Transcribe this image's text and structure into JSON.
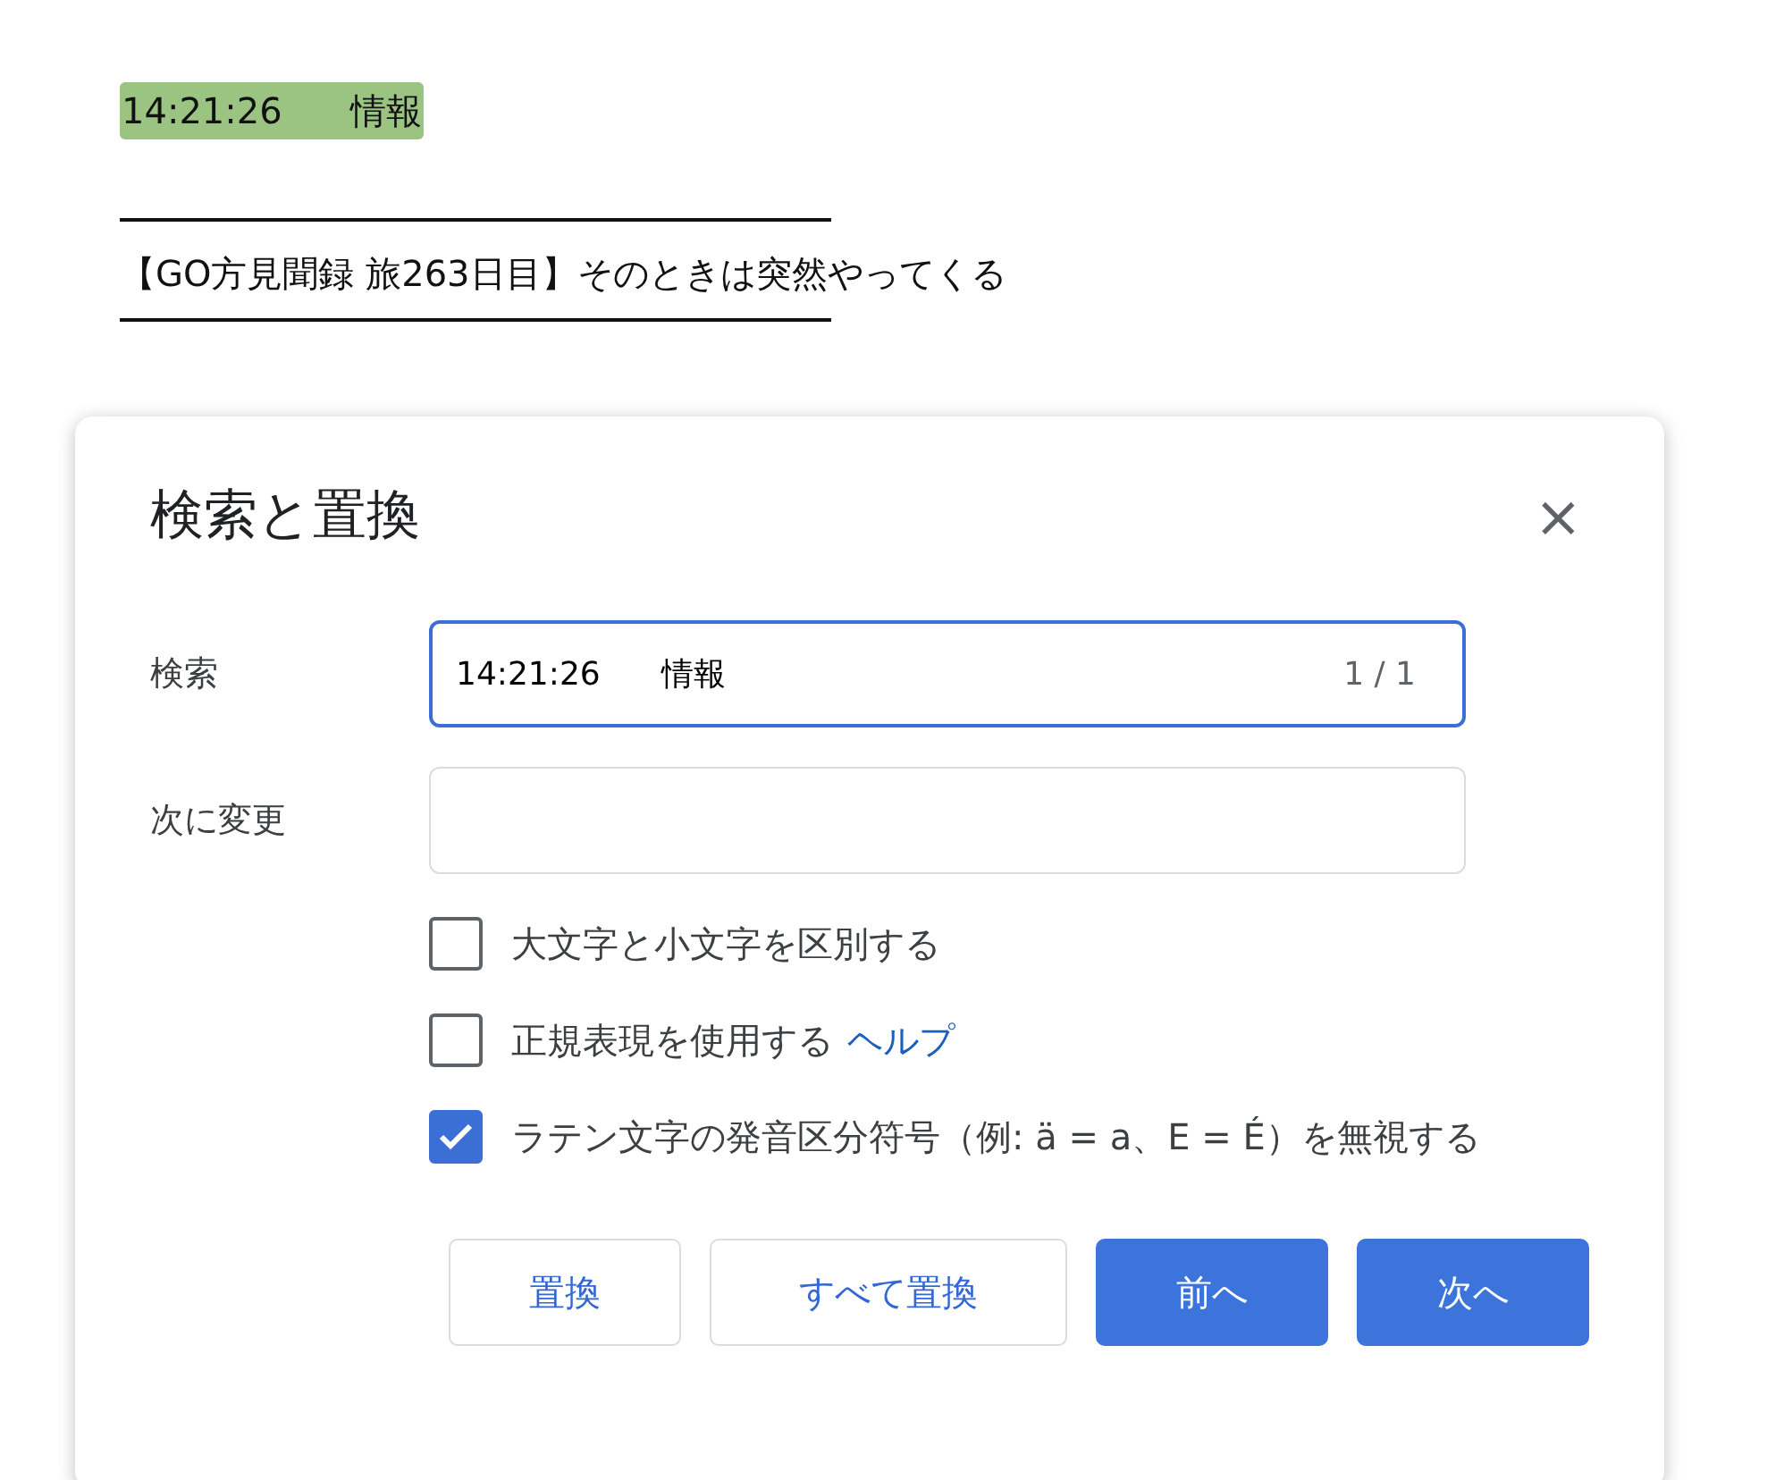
{
  "document": {
    "highlight": "14:21:26      情報",
    "heading": "【GO方見聞録 旅263日目】そのときは突然やってくる"
  },
  "dialog": {
    "title": "検索と置換",
    "close": "×",
    "search": {
      "label": "検索",
      "value": "14:21:26      情報",
      "count": "1 / 1",
      "focused": true
    },
    "replace": {
      "label": "次に変更"
    },
    "options": [
      {
        "label": "大文字と小文字を区別する",
        "checked": false
      },
      {
        "label": "正規表現を使用する",
        "link": "ヘルプ",
        "checked": false
      },
      {
        "label": "ラテン文字の発音区分符号（例: ä = a、E = É）を無視する",
        "checked": true
      }
    ],
    "buttons": [
      {
        "label": "置換",
        "kind": "secondary"
      },
      {
        "label": "すべて置換",
        "kind": "secondary"
      },
      {
        "label": "前へ",
        "kind": "primary"
      },
      {
        "label": "次へ",
        "kind": "primary"
      }
    ]
  }
}
